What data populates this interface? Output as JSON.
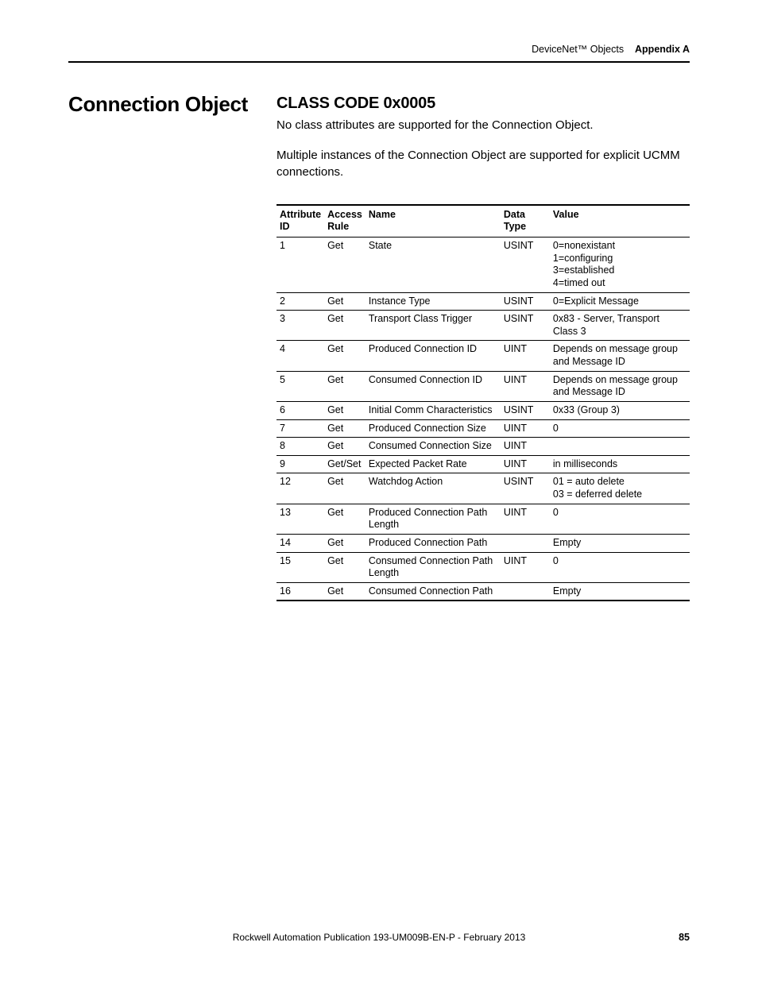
{
  "header": {
    "left": "DeviceNet™ Objects",
    "right": "Appendix A"
  },
  "side_title": "Connection Object",
  "class_code": "CLASS CODE 0x0005",
  "para1": "No class attributes are supported for the Connection Object.",
  "para2": "Multiple instances of the Connection Object are supported for explicit UCMM connections.",
  "table": {
    "headers": {
      "id": "Attribute ID",
      "rule": "Access Rule",
      "name": "Name",
      "type": "Data Type",
      "value": "Value"
    },
    "rows": [
      {
        "id": "1",
        "rule": "Get",
        "name": "State",
        "type": "USINT",
        "value": "0=nonexistant\n1=configuring\n3=established\n4=timed out"
      },
      {
        "id": "2",
        "rule": "Get",
        "name": "Instance Type",
        "type": "USINT",
        "value": "0=Explicit Message"
      },
      {
        "id": "3",
        "rule": "Get",
        "name": "Transport Class Trigger",
        "type": "USINT",
        "value": "0x83 - Server, Transport Class 3"
      },
      {
        "id": "4",
        "rule": "Get",
        "name": "Produced Connection ID",
        "type": "UINT",
        "value": "Depends on message group and Message ID"
      },
      {
        "id": "5",
        "rule": "Get",
        "name": "Consumed Connection ID",
        "type": "UINT",
        "value": "Depends on message group and Message ID"
      },
      {
        "id": "6",
        "rule": "Get",
        "name": "Initial Comm Characteristics",
        "type": "USINT",
        "value": "0x33 (Group 3)"
      },
      {
        "id": "7",
        "rule": "Get",
        "name": "Produced Connection Size",
        "type": "UINT",
        "value": "0"
      },
      {
        "id": "8",
        "rule": "Get",
        "name": "Consumed Connection Size",
        "type": "UINT",
        "value": ""
      },
      {
        "id": "9",
        "rule": "Get/Set",
        "name": "Expected Packet Rate",
        "type": "UINT",
        "value": "in milliseconds"
      },
      {
        "id": "12",
        "rule": "Get",
        "name": "Watchdog Action",
        "type": "USINT",
        "value": "01 = auto delete\n03 = deferred delete"
      },
      {
        "id": "13",
        "rule": "Get",
        "name": "Produced Connection Path Length",
        "type": "UINT",
        "value": "0"
      },
      {
        "id": "14",
        "rule": "Get",
        "name": "Produced Connection Path",
        "type": "",
        "value": "Empty"
      },
      {
        "id": "15",
        "rule": "Get",
        "name": "Consumed Connection Path Length",
        "type": "UINT",
        "value": "0"
      },
      {
        "id": "16",
        "rule": "Get",
        "name": "Consumed Connection Path",
        "type": "",
        "value": "Empty"
      }
    ]
  },
  "footer": {
    "center": "Rockwell Automation Publication 193-UM009B-EN-P - February 2013",
    "page": "85"
  }
}
